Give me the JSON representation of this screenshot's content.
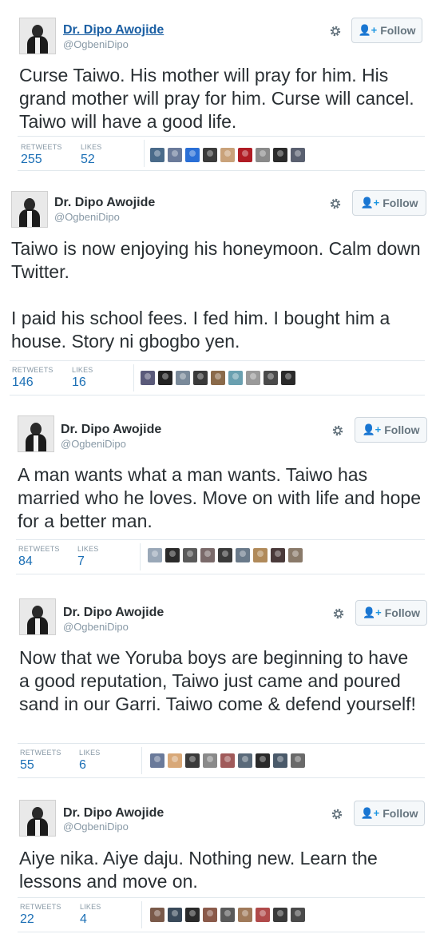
{
  "tweets": [
    {
      "name": "Dr. Dipo Awojide",
      "handle": "@OgbeniDipo",
      "follow_label": "Follow",
      "text": "Curse Taiwo. His mother will pray for him. His grand mother will pray for him. Curse will cancel. Taiwo will have a good life.",
      "retweets_label": "RETWEETS",
      "retweets": "255",
      "likes_label": "LIKES",
      "likes": "52",
      "faces": [
        "#4a6b8a",
        "#6b7b9a",
        "#2a6fd6",
        "#3b3b3b",
        "#c9a27a",
        "#b01c24",
        "#8a8a8a",
        "#2b2b2b",
        "#5a6070"
      ]
    },
    {
      "name": "Dr. Dipo Awojide",
      "handle": "@OgbeniDipo",
      "follow_label": "Follow",
      "text": "Taiwo is now enjoying his honeymoon. Calm down Twitter.\n\nI paid his school fees. I fed him. I bought him a house. Story ni gbogbo yen.",
      "retweets_label": "RETWEETS",
      "retweets": "146",
      "likes_label": "LIKES",
      "likes": "16",
      "faces": [
        "#5a5a7a",
        "#222222",
        "#7a8a9a",
        "#3a3a3a",
        "#8a6a4a",
        "#6aa0b0",
        "#9a9a9a",
        "#4a4a4a",
        "#2a2a2a"
      ]
    },
    {
      "name": "Dr. Dipo Awojide",
      "handle": "@OgbeniDipo",
      "follow_label": "Follow",
      "text": "A man wants what a man wants. Taiwo has married who he loves. Move on with life and hope for a better man.",
      "retweets_label": "RETWEETS",
      "retweets": "84",
      "likes_label": "LIKES",
      "likes": "7",
      "faces": [
        "#9aa8b8",
        "#2a2a2a",
        "#5a5a5a",
        "#7a6a6a",
        "#3a3a3a",
        "#6a7a8a",
        "#b08a5a",
        "#4a3a3a",
        "#8a7a6a"
      ]
    },
    {
      "name": "Dr. Dipo Awojide",
      "handle": "@OgbeniDipo",
      "follow_label": "Follow",
      "text": "Now that we Yoruba boys are beginning to have a good reputation, Taiwo just came and poured sand in our Garri. Taiwo come & defend yourself!",
      "retweets_label": "RETWEETS",
      "retweets": "55",
      "likes_label": "LIKES",
      "likes": "6",
      "faces": [
        "#6a7a9a",
        "#d8a878",
        "#3a3a3a",
        "#8a8a8a",
        "#a05a5a",
        "#5a6a7a",
        "#2a2a2a",
        "#4a5a6a",
        "#6a6a6a"
      ]
    },
    {
      "name": "Dr. Dipo Awojide",
      "handle": "@OgbeniDipo",
      "follow_label": "Follow",
      "text": "Aiye nika. Aiye daju. Nothing new. Learn the lessons and move on.",
      "retweets_label": "RETWEETS",
      "retweets": "22",
      "likes_label": "LIKES",
      "likes": "4",
      "faces": [
        "#7a5a4a",
        "#3a4a5a",
        "#2a2a2a",
        "#8a5a4a",
        "#5a5a5a",
        "#a07a5a",
        "#b04a4a",
        "#3a3a3a",
        "#4a4a4a"
      ]
    }
  ]
}
